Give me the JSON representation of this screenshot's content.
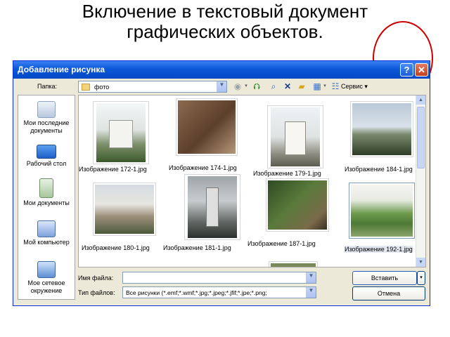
{
  "slide": {
    "title_line1": "Включение в текстовый документ",
    "title_line2": "графических объектов."
  },
  "dialog": {
    "title": "Добавление рисунка",
    "help_label": "?",
    "close_label": "✕",
    "folder_label": "Папка:",
    "folder_value": "фото",
    "tools_label": "Сервис",
    "places": [
      {
        "label": "Мои последние документы",
        "icon": "recent-documents-icon"
      },
      {
        "label": "Рабочий стол",
        "icon": "desktop-icon"
      },
      {
        "label": "Мои документы",
        "icon": "my-documents-icon"
      },
      {
        "label": "Мой компьютер",
        "icon": "my-computer-icon"
      },
      {
        "label": "Мое сетевое окружение",
        "icon": "network-icon"
      }
    ],
    "files": [
      "Изображение 172-1.jpg",
      "Изображение 174-1.jpg",
      "Изображение 179-1.jpg",
      "Изображение 184-1.jpg",
      "Изображение 180-1.jpg",
      "Изображение 181-1.jpg",
      "Изображение 187-1.jpg",
      "Изображение 192-1.jpg"
    ],
    "filename_label": "Имя файла:",
    "filename_value": "",
    "filetype_label": "Тип файлов:",
    "filetype_value": "Все рисунки (*.emf;*.wmf;*.jpg;*.jpeg;*.jfif;*.jpe;*.png;",
    "insert_label": "Вставить",
    "cancel_label": "Отмена"
  },
  "colors": {
    "accent_circle": "#cc0000",
    "titlebar": "#0a58d8"
  }
}
